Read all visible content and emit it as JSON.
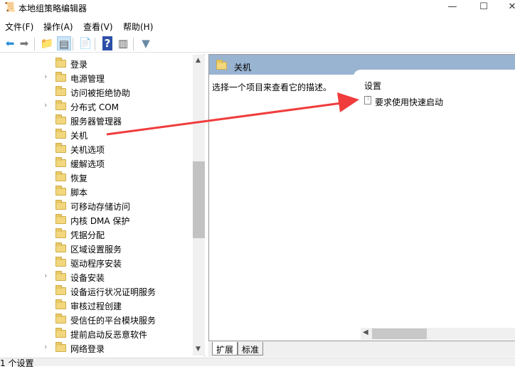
{
  "window": {
    "title": "本地组策略编辑器",
    "minimize": "—",
    "maximize": "☐",
    "close": "✕"
  },
  "menu": [
    "文件(F)",
    "操作(A)",
    "查看(V)",
    "帮助(H)"
  ],
  "toolbar": [
    {
      "name": "back-icon",
      "glyph": "⬅",
      "color": "#2a8fd8"
    },
    {
      "name": "forward-icon",
      "glyph": "➡",
      "color": "#777"
    },
    {
      "name": "up-folder-icon",
      "glyph": "📁",
      "color": "#d9b64f"
    },
    {
      "name": "show-hide-tree-icon",
      "glyph": "▤",
      "color": "#555"
    },
    {
      "name": "export-list-icon",
      "glyph": "📄",
      "color": "#666"
    },
    {
      "name": "help-icon",
      "glyph": "?",
      "color": "#fff"
    },
    {
      "name": "show-action-pane-icon",
      "glyph": "▥",
      "color": "#555"
    },
    {
      "name": "filter-icon",
      "glyph": "▼",
      "color": "#6a8aa6"
    }
  ],
  "tree": [
    {
      "label": "登录",
      "expandable": false
    },
    {
      "label": "电源管理",
      "expandable": true
    },
    {
      "label": "访问被拒绝协助",
      "expandable": false
    },
    {
      "label": "分布式 COM",
      "expandable": true
    },
    {
      "label": "服务器管理器",
      "expandable": false
    },
    {
      "label": "关机",
      "expandable": false,
      "selected": true
    },
    {
      "label": "关机选项",
      "expandable": false
    },
    {
      "label": "缓解选项",
      "expandable": false
    },
    {
      "label": "恢复",
      "expandable": false
    },
    {
      "label": "脚本",
      "expandable": false
    },
    {
      "label": "可移动存储访问",
      "expandable": false
    },
    {
      "label": "内核 DMA 保护",
      "expandable": false
    },
    {
      "label": "凭据分配",
      "expandable": false
    },
    {
      "label": "区域设置服务",
      "expandable": false
    },
    {
      "label": "驱动程序安装",
      "expandable": false
    },
    {
      "label": "设备安装",
      "expandable": true
    },
    {
      "label": "设备运行状况证明服务",
      "expandable": false
    },
    {
      "label": "审核过程创建",
      "expandable": false
    },
    {
      "label": "受信任的平台模块服务",
      "expandable": false
    },
    {
      "label": "提前启动反恶意软件",
      "expandable": false
    },
    {
      "label": "网络登录",
      "expandable": true
    }
  ],
  "details": {
    "header": "关机",
    "description": "选择一个项目来查看它的描述。",
    "column_header": "设置",
    "settings": [
      "要求使用快速启动"
    ]
  },
  "tabs": [
    "扩展",
    "标准"
  ],
  "status": "1 个设置",
  "colors": {
    "header": "#99b4d1",
    "annotation_arrow": "#f03c3c"
  }
}
